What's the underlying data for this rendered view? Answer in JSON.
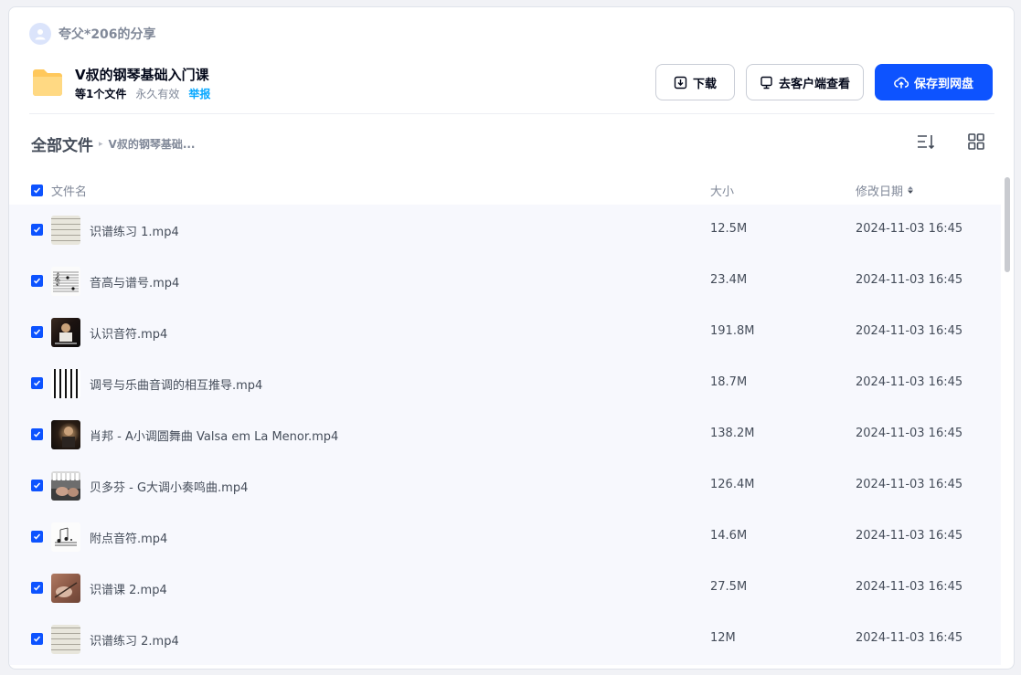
{
  "share": {
    "sharer": "夸父*206的分享",
    "folder_title": "V叔的钢琴基础入门课",
    "file_count": "等1个文件",
    "validity": "永久有效",
    "report": "举报"
  },
  "actions": {
    "download": "下载",
    "client": "去客户端查看",
    "save": "保存到网盘"
  },
  "breadcrumb": {
    "root": "全部文件",
    "separator": "▸",
    "current": "V叔的钢琴基础..."
  },
  "table": {
    "col_name": "文件名",
    "col_size": "大小",
    "col_date": "修改日期",
    "rows": [
      {
        "name": "识谱练习 1.mp4",
        "size": "12.5M",
        "date": "2024-11-03 16:45",
        "thumb": "th-sheet",
        "checked": true
      },
      {
        "name": "音高与谱号.mp4",
        "size": "23.4M",
        "date": "2024-11-03 16:45",
        "thumb": "th-staff",
        "checked": true
      },
      {
        "name": "认识音符.mp4",
        "size": "191.8M",
        "date": "2024-11-03 16:45",
        "thumb": "th-dark",
        "checked": true
      },
      {
        "name": "调号与乐曲音调的相互推导.mp4",
        "size": "18.7M",
        "date": "2024-11-03 16:45",
        "thumb": "th-keys",
        "checked": true
      },
      {
        "name": "肖邦 - A小调圆舞曲 Valsa em La Menor.mp4",
        "size": "138.2M",
        "date": "2024-11-03 16:45",
        "thumb": "th-portrait",
        "checked": true
      },
      {
        "name": "贝多芬 - G大调小奏鸣曲.mp4",
        "size": "126.4M",
        "date": "2024-11-03 16:45",
        "thumb": "th-hands",
        "checked": true
      },
      {
        "name": "附点音符.mp4",
        "size": "14.6M",
        "date": "2024-11-03 16:45",
        "thumb": "th-notes",
        "checked": true
      },
      {
        "name": "识谱课 2.mp4",
        "size": "27.5M",
        "date": "2024-11-03 16:45",
        "thumb": "th-brown",
        "checked": true
      },
      {
        "name": "识谱练习 2.mp4",
        "size": "12M",
        "date": "2024-11-03 16:45",
        "thumb": "th-sheet",
        "checked": true
      }
    ]
  },
  "colors": {
    "accent": "#0d53ff",
    "link": "#06a7ff",
    "row_bg": "#f7f8fd",
    "folder": "#ffc85c"
  }
}
